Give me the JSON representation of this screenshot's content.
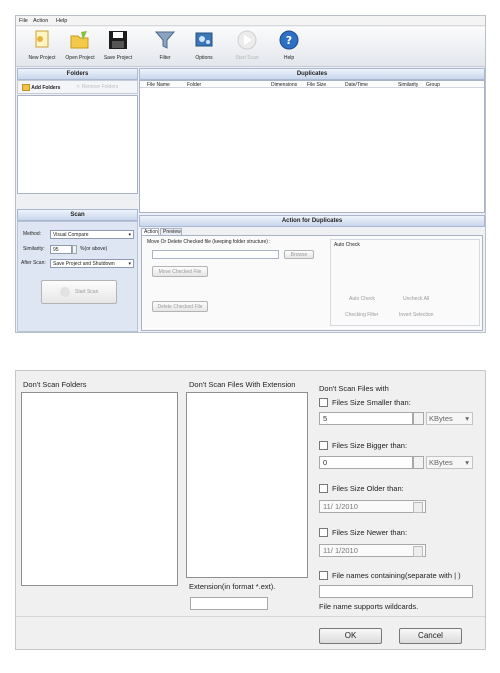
{
  "menu": [
    "File",
    "Action",
    "Help"
  ],
  "toolbar": {
    "new_project": "New Project",
    "open_project": "Open Project",
    "save_project": "Save Project",
    "filter": "Filter",
    "options": "Options",
    "start_scan": "Start Scan",
    "help": "Help"
  },
  "folders_panel": {
    "title": "Folders",
    "add_folders": "Add Folders",
    "remove_folders": "Remove Folders"
  },
  "scan_panel": {
    "title": "Scan",
    "method_label": "Method:",
    "method_value": "Visual Compare",
    "similarity_label": "Similarity:",
    "similarity_value": "95",
    "similarity_unit": "%(or above)",
    "after_scan_label": "After Scan:",
    "after_scan_value": "Save Project and Shutdown",
    "start_scan": "Start Scan"
  },
  "duplicates_panel": {
    "title": "Duplicates",
    "columns": [
      "File Name",
      "Folder",
      "Dimensions",
      "File Size",
      "Date/Time",
      "Similarity",
      "Group"
    ]
  },
  "action_panel": {
    "title": "Action for Duplicates",
    "tabs": [
      "Action",
      "Preview"
    ],
    "move_delete_label": "Move Or Delete Checked file (keeping folder structure) :",
    "browse": "Browse",
    "move_checked": "Move Checked File",
    "delete_checked": "Delete Checked File",
    "auto_check_title": "Auto Check",
    "auto_check": "Auto Check",
    "uncheck_all": "Uncheck All",
    "checking_filter": "Checking Filter",
    "invert_selection": "Invert Selection"
  },
  "filter_dialog": {
    "dont_scan_folders": "Don't Scan Folders",
    "dont_scan_ext": "Don't Scan Files With Extension",
    "extension_hint": "Extension(in format *.ext).",
    "dont_scan_with": "Don't Scan Files with",
    "size_smaller": "Files Size Smaller than:",
    "size_smaller_value": "5",
    "size_smaller_unit": "KBytes",
    "size_bigger": "Files Size Bigger than:",
    "size_bigger_value": "0",
    "size_bigger_unit": "KBytes",
    "older": "Files Size Older than:",
    "older_value": "11/  1/2010",
    "newer": "Files Size Newer than:",
    "newer_value": "11/  1/2010",
    "names_containing": "File names containing(separate with | )",
    "wildcards_note": "File name supports wildcards.",
    "ok": "OK",
    "cancel": "Cancel"
  },
  "colors": {
    "panel_header": "#c8d6ec",
    "window_bg": "#eef0f4",
    "dialog_bg": "#f0f0f0"
  }
}
